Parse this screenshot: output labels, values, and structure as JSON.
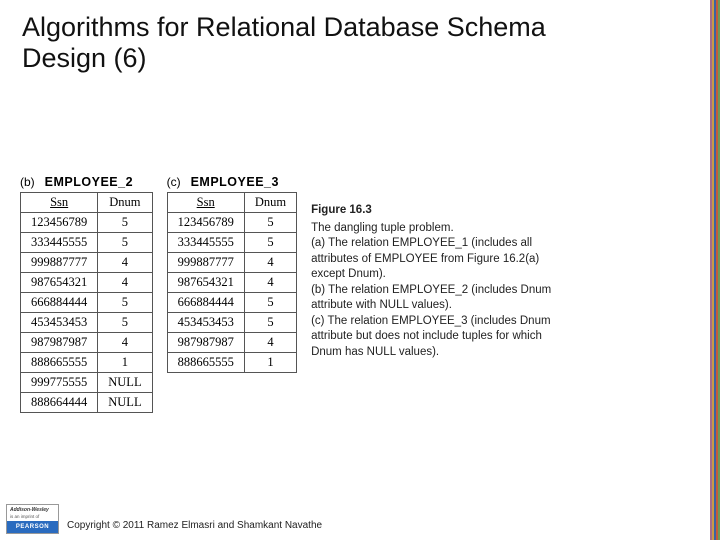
{
  "title": "Algorithms for Relational Database Schema Design (6)",
  "table_b": {
    "letter": "(b)",
    "name": "EMPLOYEE_2",
    "headers": [
      "Ssn",
      "Dnum"
    ],
    "rows": [
      [
        "123456789",
        "5"
      ],
      [
        "333445555",
        "5"
      ],
      [
        "999887777",
        "4"
      ],
      [
        "987654321",
        "4"
      ],
      [
        "666884444",
        "5"
      ],
      [
        "453453453",
        "5"
      ],
      [
        "987987987",
        "4"
      ],
      [
        "888665555",
        "1"
      ],
      [
        "999775555",
        "NULL"
      ],
      [
        "888664444",
        "NULL"
      ]
    ]
  },
  "table_c": {
    "letter": "(c)",
    "name": "EMPLOYEE_3",
    "headers": [
      "Ssn",
      "Dnum"
    ],
    "rows": [
      [
        "123456789",
        "5"
      ],
      [
        "333445555",
        "5"
      ],
      [
        "999887777",
        "4"
      ],
      [
        "987654321",
        "4"
      ],
      [
        "666884444",
        "5"
      ],
      [
        "453453453",
        "5"
      ],
      [
        "987987987",
        "4"
      ],
      [
        "888665555",
        "1"
      ]
    ]
  },
  "figure": {
    "label": "Figure 16.3",
    "line1": "The dangling tuple problem.",
    "line_a": "(a) The relation EMPLOYEE_1 (includes all attributes of EMPLOYEE from Figure 16.2(a) except Dnum).",
    "line_b": "(b) The relation EMPLOYEE_2 (includes Dnum attribute with NULL values).",
    "line_c": "(c) The relation EMPLOYEE_3 (includes Dnum attribute but does not include tuples for which Dnum has NULL values)."
  },
  "publisher": {
    "brand_top": "Addison-Wesley",
    "brand_sub": "is an imprint of",
    "brand": "PEARSON"
  },
  "copyright": "Copyright © 2011 Ramez Elmasri and Shamkant Navathe"
}
